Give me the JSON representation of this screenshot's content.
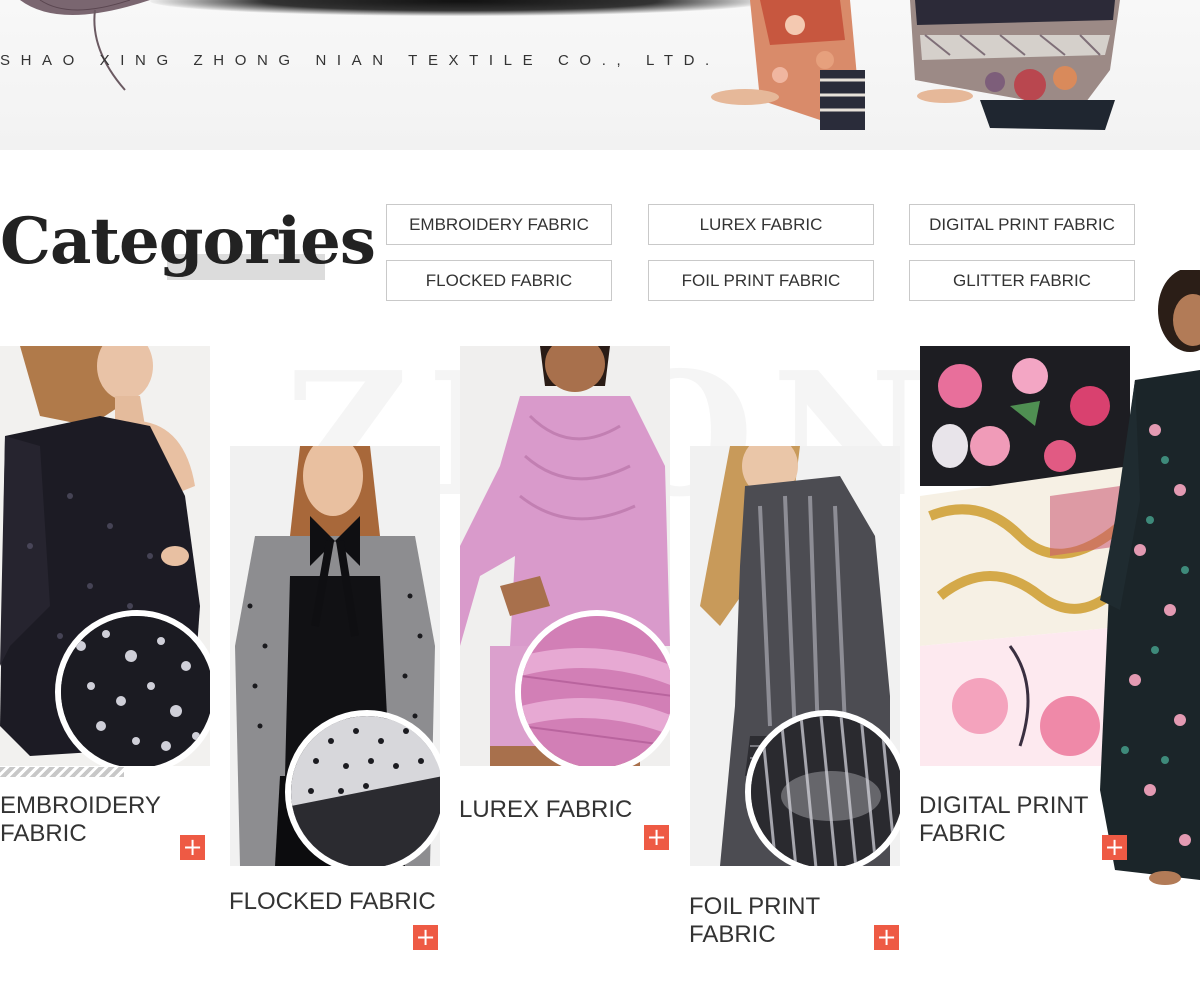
{
  "header": {
    "company_name": "SHAO XING ZHONG NIAN TEXTILE CO., LTD."
  },
  "categories": {
    "title": "Categories",
    "buttons": [
      "EMBROIDERY FABRIC",
      "LUREX FABRIC",
      "DIGITAL PRINT FABRIC",
      "FLOCKED FABRIC",
      "FOIL PRINT FABRIC",
      "GLITTER FABRIC"
    ]
  },
  "watermark": "ZHONG",
  "products": [
    {
      "label": "EMBROIDERY\nFABRIC",
      "add": "+"
    },
    {
      "label": "FLOCKED FABRIC",
      "add": "+"
    },
    {
      "label": "LUREX FABRIC",
      "add": "+"
    },
    {
      "label": "FOIL PRINT\nFABRIC",
      "add": "+"
    },
    {
      "label": "DIGITAL PRINT\nFABRIC",
      "add": "+"
    }
  ],
  "colors": {
    "accent": "#ee5a44",
    "heading": "#222222",
    "divider": "#c9c9c9"
  }
}
